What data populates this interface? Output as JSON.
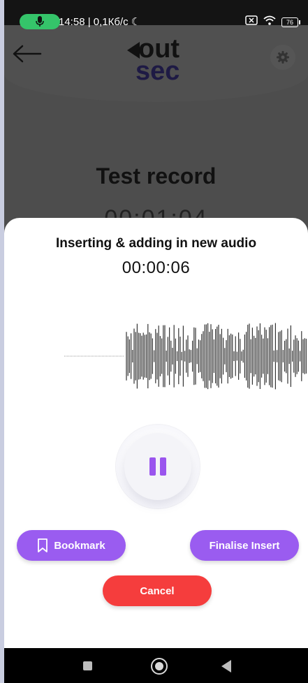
{
  "status_bar": {
    "time_speed": "14:58 | 0,1Кб/c",
    "battery": "76",
    "icons": [
      "mic-icon",
      "moon-icon",
      "close-box-icon",
      "wifi-icon",
      "battery-icon"
    ]
  },
  "app_header": {
    "logo_line1": "out",
    "logo_line2": "sec",
    "icons": [
      "back-arrow-icon",
      "gear-icon"
    ]
  },
  "recording": {
    "title": "Test record",
    "timer": "00:01:04"
  },
  "sheet": {
    "title": "Inserting & adding in new audio",
    "timer": "00:00:06",
    "bookmark_label": "Bookmark",
    "finalise_label": "Finalise Insert",
    "cancel_label": "Cancel"
  },
  "colors": {
    "accent": "#9a5cf0",
    "cancel": "#f53d3d",
    "mic_pill": "#35c46a"
  }
}
